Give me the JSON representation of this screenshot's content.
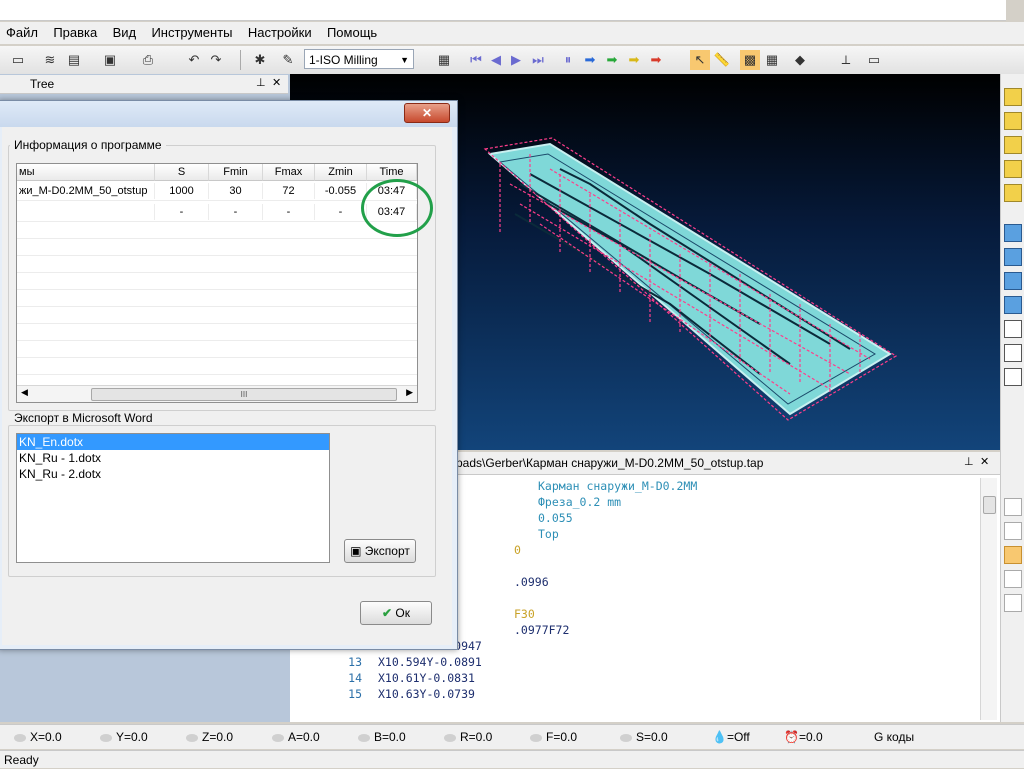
{
  "menu": [
    "Файл",
    "Правка",
    "Вид",
    "Инструменты",
    "Настройки",
    "Помощь"
  ],
  "toolbar": {
    "mode_select": "1-ISO Milling"
  },
  "tree": {
    "title": "Tree"
  },
  "viewport": {
    "colors": {
      "board": "#7fd8d8",
      "toolpath": "#ff3d8a"
    }
  },
  "code": {
    "path": "pads\\Gerber\\Карман снаружи_M-D0.2MM_50_otstup.tap",
    "lines": [
      {
        "n": "",
        "text": "Карман снаружи_M-D0.2MM",
        "indent": 160,
        "color": "#2d8fb6"
      },
      {
        "n": "",
        "text": "Фреза_0.2 mm",
        "indent": 160,
        "color": "#2d8fb6"
      },
      {
        "n": "",
        "text": "0.055",
        "indent": 160,
        "color": "#2d8fb6"
      },
      {
        "n": "",
        "text": "Top",
        "indent": 160,
        "color": "#2d8fb6"
      },
      {
        "n": "",
        "text": "0",
        "indent": 136,
        "color": "#c9a227"
      },
      {
        "n": "",
        "text": "",
        "indent": 0,
        "color": "#000"
      },
      {
        "n": "",
        "text": ".0996",
        "indent": 136,
        "color": "#1d2e6e"
      },
      {
        "n": "",
        "text": "",
        "indent": 0,
        "color": "#000"
      },
      {
        "n": "",
        "text": "F30",
        "indent": 136,
        "color": "#c9a227"
      },
      {
        "n": "",
        "text": ".0977F72",
        "indent": 136,
        "color": "#1d2e6e"
      },
      {
        "n": "12",
        "text": "X10.573Y-0.0947",
        "indent": 0,
        "color": "#1d2e6e"
      },
      {
        "n": "13",
        "text": "X10.594Y-0.0891",
        "indent": 0,
        "color": "#1d2e6e"
      },
      {
        "n": "14",
        "text": "X10.61Y-0.0831",
        "indent": 0,
        "color": "#1d2e6e"
      },
      {
        "n": "15",
        "text": "X10.63Y-0.0739",
        "indent": 0,
        "color": "#1d2e6e"
      }
    ]
  },
  "status": {
    "x": "X=0.0",
    "y": "Y=0.0",
    "z": "Z=0.0",
    "a": "A=0.0",
    "b": "B=0.0",
    "r": "R=0.0",
    "f": "F=0.0",
    "s": "S=0.0",
    "coolant": "=Off",
    "timer": "=0.0",
    "gcodes": "G коды",
    "ready": "Ready"
  },
  "dialog": {
    "close": "✕",
    "info_group": "Информация о программе",
    "columns": [
      "мы",
      "S",
      "Fmin",
      "Fmax",
      "Zmin",
      "Time"
    ],
    "rows": [
      [
        "жи_M-D0.2MM_50_otstup",
        "1000",
        "30",
        "72",
        "-0.055",
        "03:47"
      ],
      [
        "",
        "-",
        "-",
        "-",
        "-",
        "03:47"
      ]
    ],
    "scroll_thumb": "III",
    "export_group": "Экспорт в Microsoft Word",
    "templates": [
      "KN_En.dotx",
      "KN_Ru - 1.dotx",
      "KN_Ru - 2.dotx"
    ],
    "export_btn": "Экспорт",
    "ok_btn": "Ок",
    "highlight_color": "#22a04a"
  }
}
